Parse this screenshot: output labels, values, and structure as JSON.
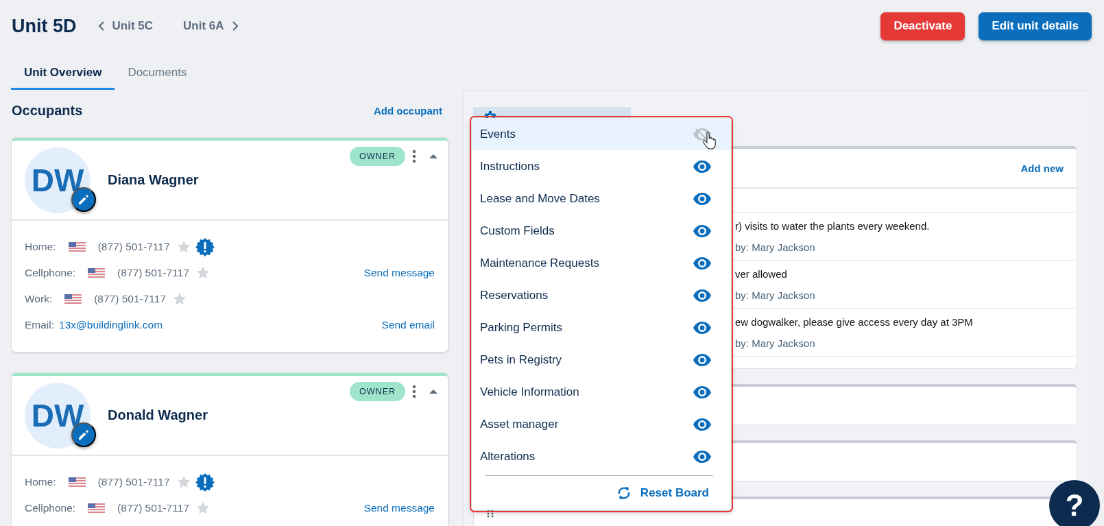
{
  "unit": {
    "title": "Unit 5D",
    "prev": "Unit 5C",
    "next": "Unit 6A"
  },
  "actions": [
    {
      "label": "Deactivate",
      "kind": "danger"
    },
    {
      "label": "Edit unit details",
      "kind": "primary"
    }
  ],
  "tabs": [
    {
      "label": "Unit Overview",
      "selected": true
    },
    {
      "label": "Documents",
      "selected": false
    }
  ],
  "occupants": {
    "title": "Occupants",
    "add_label": "Add occupant",
    "cards": [
      {
        "initials": "DW",
        "name": "Diana Wagner",
        "role": "OWNER",
        "expanded": true,
        "contacts": [
          {
            "kind": "phone",
            "label": "Home:",
            "value": "(877) 501-7117",
            "starred": false,
            "alert": true
          },
          {
            "kind": "phone",
            "label": "Cellphone:",
            "value": "(877) 501-7117",
            "starred": false,
            "alert": false,
            "action": "Send message"
          },
          {
            "kind": "phone",
            "label": "Work:",
            "value": "(877) 501-7117",
            "starred": false,
            "alert": false
          },
          {
            "kind": "email",
            "label": "Email:",
            "value": "13x@buildinglink.com",
            "action": "Send email"
          }
        ]
      },
      {
        "initials": "DW",
        "name": "Donald Wagner",
        "role": "OWNER",
        "expanded": true,
        "contacts": [
          {
            "kind": "phone",
            "label": "Home:",
            "value": "(877) 501-7117",
            "starred": false,
            "alert": true
          },
          {
            "kind": "phone",
            "label": "Cellphone:",
            "value": "(877) 501-7117",
            "starred": false,
            "alert": false,
            "action": "Send message"
          }
        ]
      }
    ]
  },
  "board": {
    "sections": [
      {
        "kind": "notes",
        "add_label": "Add new",
        "notes": [
          {
            "text": "r) visits to water the plants every weekend.",
            "author": "by: Mary Jackson"
          },
          {
            "text": "ver allowed",
            "author": "by: Mary Jackson"
          },
          {
            "text": "ew dogwalker, please give access every day at 3PM",
            "author": "by: Mary Jackson"
          }
        ]
      },
      {
        "kind": "empty"
      },
      {
        "kind": "empty"
      },
      {
        "kind": "titled"
      }
    ]
  },
  "menu": {
    "items": [
      {
        "label": "Events",
        "visible": false,
        "highlighted": true
      },
      {
        "label": "Instructions",
        "visible": true,
        "highlighted": false
      },
      {
        "label": "Lease and Move Dates",
        "visible": true,
        "highlighted": false
      },
      {
        "label": "Custom Fields",
        "visible": true,
        "highlighted": false
      },
      {
        "label": "Maintenance Requests",
        "visible": true,
        "highlighted": false
      },
      {
        "label": "Reservations",
        "visible": true,
        "highlighted": false
      },
      {
        "label": "Parking Permits",
        "visible": true,
        "highlighted": false
      },
      {
        "label": "Pets in Registry",
        "visible": true,
        "highlighted": false
      },
      {
        "label": "Vehicle Information",
        "visible": true,
        "highlighted": false
      },
      {
        "label": "Asset manager",
        "visible": true,
        "highlighted": false
      },
      {
        "label": "Alterations",
        "visible": true,
        "highlighted": false
      }
    ],
    "reset_label": "Reset Board"
  },
  "help_label": "?"
}
